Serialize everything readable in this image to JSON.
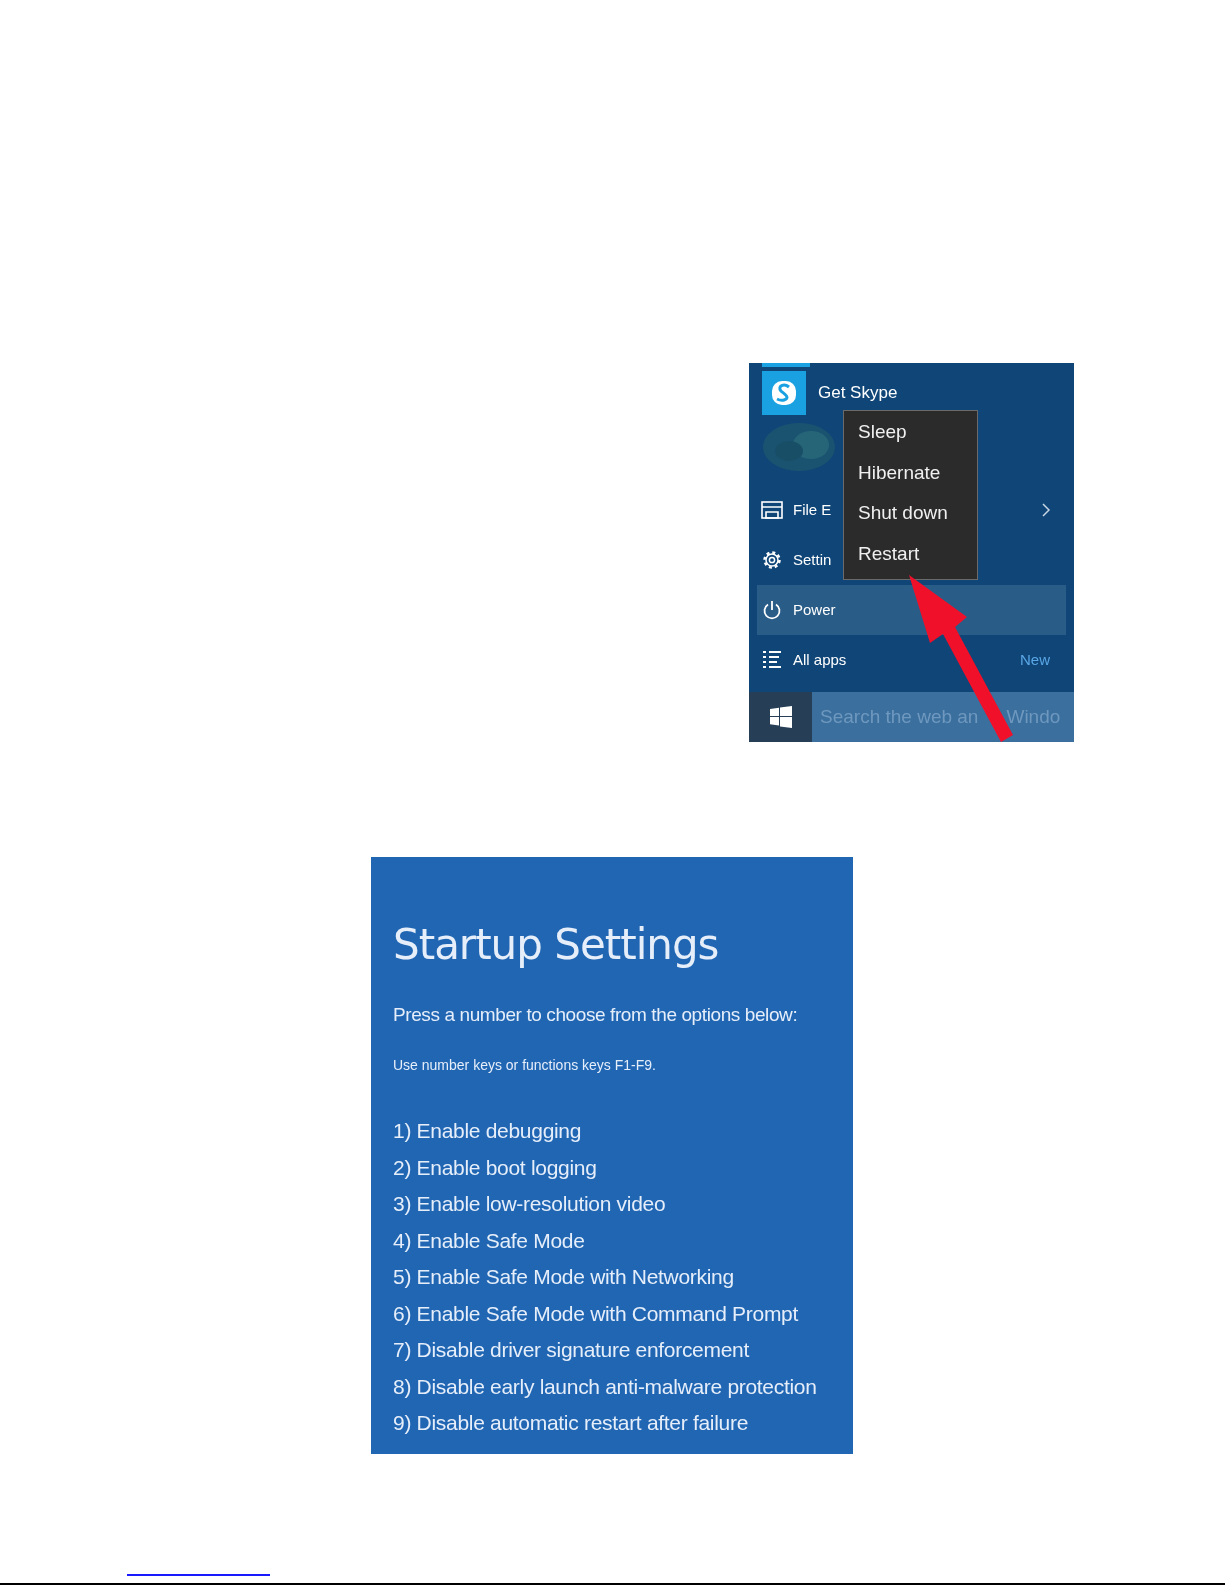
{
  "start_menu": {
    "tiles": [
      {
        "label": "Get Skype"
      }
    ],
    "items": [
      {
        "kind": "files",
        "label": "File E",
        "selected": false,
        "chevron": true
      },
      {
        "kind": "settings",
        "label": "Settin",
        "selected": false,
        "chevron": false
      },
      {
        "kind": "power",
        "label": "Power",
        "selected": true,
        "chevron": false
      },
      {
        "kind": "apps",
        "label": "All apps",
        "selected": false,
        "chevron": false,
        "badge": "New"
      }
    ],
    "power_menu": {
      "items": [
        {
          "label": "Sleep"
        },
        {
          "label": "Hibernate"
        },
        {
          "label": "Shut down"
        },
        {
          "label": "Restart"
        }
      ]
    },
    "search": {
      "placeholder": "Search the web an",
      "placeholder_tail": "Windo"
    }
  },
  "startup_settings": {
    "title": "Startup Settings",
    "prompt": "Press a number to choose from the options below:",
    "hint": "Use number keys or functions keys F1-F9.",
    "options": [
      "1) Enable debugging",
      "2) Enable boot logging",
      "3) Enable low-resolution video",
      "4) Enable Safe Mode",
      "5) Enable Safe Mode with Networking",
      "6) Enable Safe Mode with Command Prompt",
      "7) Disable driver signature enforcement",
      "8) Disable early launch anti-malware protection",
      "9) Disable automatic restart after failure"
    ]
  }
}
